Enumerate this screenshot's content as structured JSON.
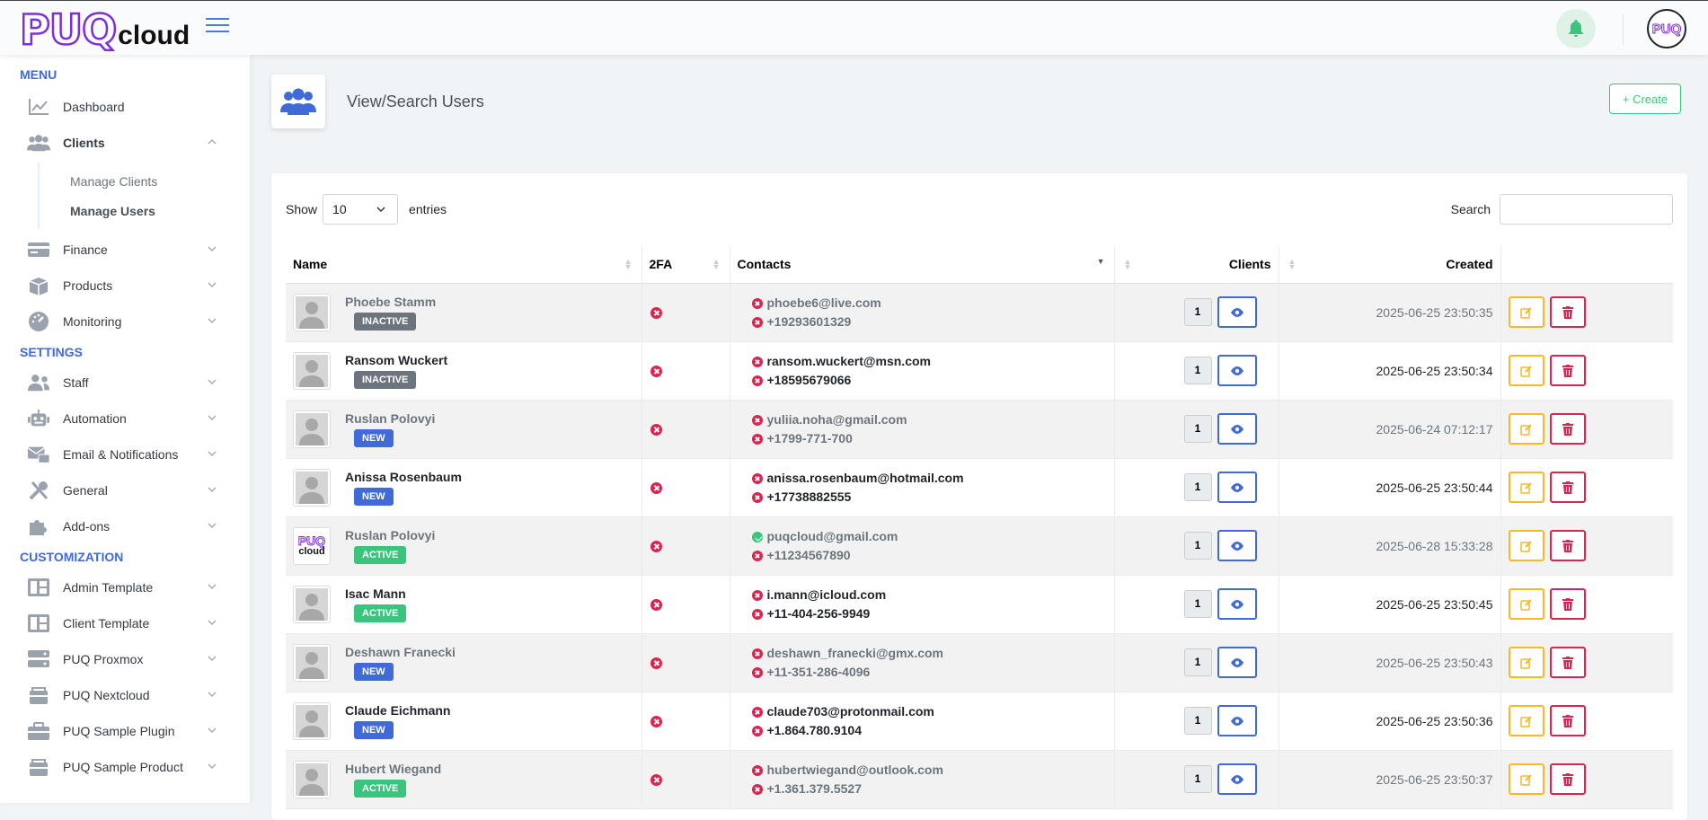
{
  "app": {
    "logo_main": "PUQ",
    "logo_sub": "cloud",
    "avatar_text": "PUQ"
  },
  "sidebar": {
    "sections": {
      "menu": "MENU",
      "settings": "SETTINGS",
      "customization": "CUSTOMIZATION"
    },
    "menu": [
      {
        "label": "Dashboard",
        "icon": "chart-line-icon"
      },
      {
        "label": "Clients",
        "icon": "users-icon"
      },
      {
        "label": "Finance",
        "icon": "credit-card-icon"
      },
      {
        "label": "Products",
        "icon": "box-icon"
      },
      {
        "label": "Monitoring",
        "icon": "gauge-icon"
      }
    ],
    "clients_sub": [
      "Manage Clients",
      "Manage Users"
    ],
    "settings": [
      {
        "label": "Staff",
        "icon": "users-icon"
      },
      {
        "label": "Automation",
        "icon": "robot-icon"
      },
      {
        "label": "Email & Notifications",
        "icon": "mail-icon"
      },
      {
        "label": "General",
        "icon": "tools-icon"
      },
      {
        "label": "Add-ons",
        "icon": "puzzle-icon"
      }
    ],
    "customization": [
      {
        "label": "Admin Template",
        "icon": "template-icon"
      },
      {
        "label": "Client Template",
        "icon": "template-icon"
      },
      {
        "label": "PUQ Proxmox",
        "icon": "server-icon"
      },
      {
        "label": "PUQ Nextcloud",
        "icon": "cube-icon"
      },
      {
        "label": "PUQ Sample Plugin",
        "icon": "briefcase-icon"
      },
      {
        "label": "PUQ Sample Product",
        "icon": "cube-icon"
      }
    ]
  },
  "page": {
    "title": "View/Search Users",
    "create_label": "+ Create"
  },
  "table_controls": {
    "show": "Show",
    "entries_value": "10",
    "entries": "entries",
    "search": "Search"
  },
  "columns": {
    "name": "Name",
    "twofa": "2FA",
    "contacts": "Contacts",
    "clients": "Clients",
    "created": "Created"
  },
  "rows": [
    {
      "name": "Phoebe Stamm",
      "status": "INACTIVE",
      "email": "phoebe6@live.com",
      "email_verified": false,
      "phone": "+19293601329",
      "clients": "1",
      "created": "2025-06-25 23:50:35",
      "muted": true
    },
    {
      "name": "Ransom Wuckert",
      "status": "INACTIVE",
      "email": "ransom.wuckert@msn.com",
      "email_verified": false,
      "phone": "+18595679066",
      "clients": "1",
      "created": "2025-06-25 23:50:34",
      "muted": false
    },
    {
      "name": "Ruslan Polovyi",
      "status": "NEW",
      "email": "yuliia.noha@gmail.com",
      "email_verified": false,
      "phone": "+1799-771-700",
      "clients": "1",
      "created": "2025-06-24 07:12:17",
      "muted": true
    },
    {
      "name": "Anissa Rosenbaum",
      "status": "NEW",
      "email": "anissa.rosenbaum@hotmail.com",
      "email_verified": false,
      "phone": "+17738882555",
      "clients": "1",
      "created": "2025-06-25 23:50:44",
      "muted": false
    },
    {
      "name": "Ruslan Polovyi",
      "status": "ACTIVE",
      "email": "puqcloud@gmail.com",
      "email_verified": true,
      "phone": "+11234567890",
      "clients": "1",
      "created": "2025-06-28 15:33:28",
      "muted": true,
      "logo_avatar": true
    },
    {
      "name": "Isac Mann",
      "status": "ACTIVE",
      "email": "i.mann@icloud.com",
      "email_verified": false,
      "phone": "+11-404-256-9949",
      "clients": "1",
      "created": "2025-06-25 23:50:45",
      "muted": false
    },
    {
      "name": "Deshawn Franecki",
      "status": "NEW",
      "email": "deshawn_franecki@gmx.com",
      "email_verified": false,
      "phone": "+11-351-286-4096",
      "clients": "1",
      "created": "2025-06-25 23:50:43",
      "muted": true
    },
    {
      "name": "Claude Eichmann",
      "status": "NEW",
      "email": "claude703@protonmail.com",
      "email_verified": false,
      "phone": "+1.864.780.9104",
      "clients": "1",
      "created": "2025-06-25 23:50:36",
      "muted": false
    },
    {
      "name": "Hubert Wiegand",
      "status": "ACTIVE",
      "email": "hubertwiegand@outlook.com",
      "email_verified": false,
      "phone": "+1.361.379.5527",
      "clients": "1",
      "created": "2025-06-25 23:50:37",
      "muted": true
    }
  ],
  "colors": {
    "primary": "#3f6ad8",
    "success": "#3ac47d",
    "warning": "#f7b924",
    "danger": "#d92550",
    "brand": "#7b2fd6"
  }
}
